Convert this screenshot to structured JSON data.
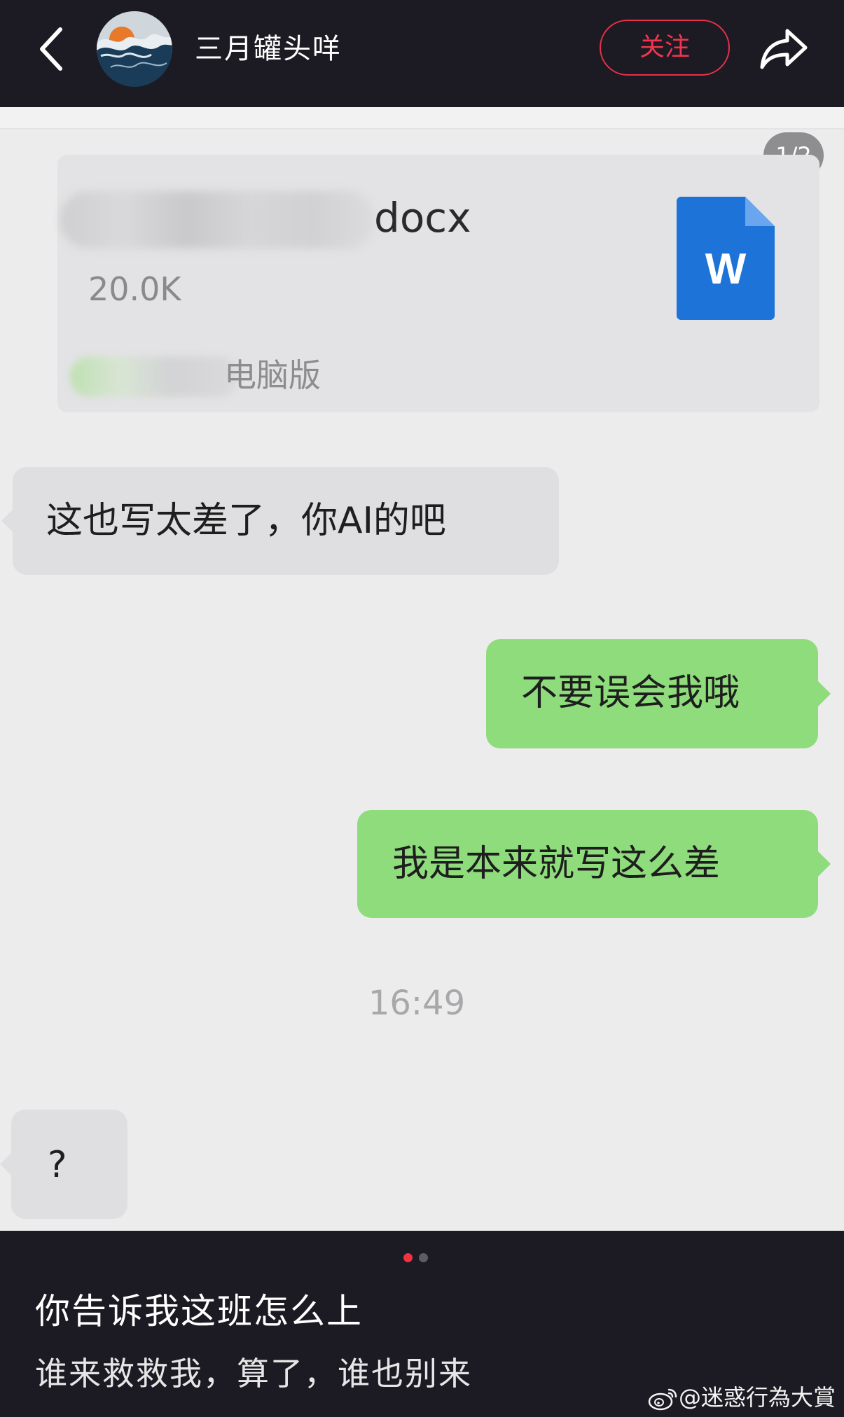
{
  "header": {
    "author_name": "三月罐头咩",
    "follow_label": "关注",
    "icons": {
      "back": "chevron-left-icon",
      "share": "share-arrow-icon",
      "avatar": "avatar-image"
    }
  },
  "screenshot": {
    "page_counter": "1/2",
    "file_card": {
      "file_ext": "docx",
      "file_size": "20.0K",
      "source_label": "电脑版",
      "icon": "word-doc-icon",
      "icon_letter": "W"
    },
    "messages": [
      {
        "side": "left",
        "text": "这也写太差了，你AI的吧"
      },
      {
        "side": "right",
        "text": "不要误会我哦"
      },
      {
        "side": "right",
        "text": "我是本来就写这么差"
      },
      {
        "side": "left",
        "text": "?"
      }
    ],
    "timestamp": "16:49"
  },
  "caption": {
    "title": "你告诉我这班怎么上",
    "body": "谁来救救我，算了，谁也别来",
    "pagination": {
      "current": 1,
      "total": 2
    },
    "watermark": "@迷惑行為大賞"
  },
  "colors": {
    "bar_bg": "#1c1a22",
    "follow_red": "#e8304a",
    "bubble_green": "#8fdc7c",
    "bubble_gray": "#dfdfe1",
    "word_blue": "#1e73d8",
    "dot_active": "#ef3340",
    "dot_inactive": "#5c5c62"
  }
}
